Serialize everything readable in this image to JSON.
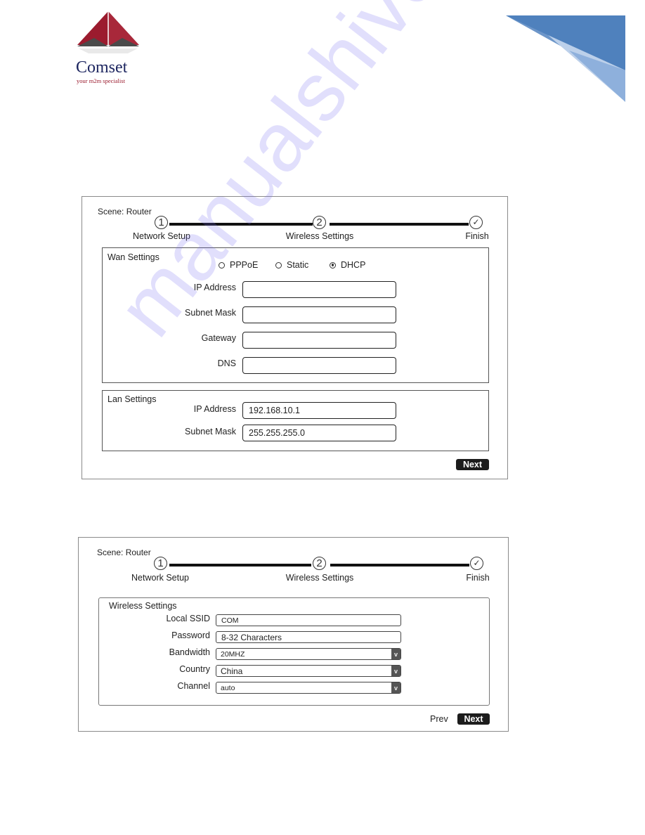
{
  "header": {
    "logo_name": "Comset",
    "logo_tagline": "your m2m specialist",
    "brand_colors": {
      "triangle_red": "#9b1b2e",
      "triangle_gray": "#4a4a4a",
      "name_navy": "#1d2660",
      "corner_blue": "#4f81bd"
    }
  },
  "screen1": {
    "scene_label": "Scene: Router",
    "steps": [
      {
        "number": "1",
        "label": "Network Setup"
      },
      {
        "number": "2",
        "label": "Wireless Settings"
      },
      {
        "icon": "check-icon",
        "label": "Finish"
      }
    ],
    "wan": {
      "title": "Wan Settings",
      "modes": [
        {
          "label": "PPPoE",
          "selected": false
        },
        {
          "label": "Static",
          "selected": false
        },
        {
          "label": "DHCP",
          "selected": true
        }
      ],
      "fields": [
        {
          "label": "IP Address",
          "value": ""
        },
        {
          "label": "Subnet Mask",
          "value": ""
        },
        {
          "label": "Gateway",
          "value": ""
        },
        {
          "label": "DNS",
          "value": ""
        }
      ]
    },
    "lan": {
      "title": "Lan Settings",
      "fields": [
        {
          "label": "IP Address",
          "value": "192.168.10.1"
        },
        {
          "label": "Subnet Mask",
          "value": "255.255.255.0"
        }
      ]
    },
    "next_label": "Next"
  },
  "screen2": {
    "scene_label": "Scene: Router",
    "steps": [
      {
        "number": "1",
        "label": "Network Setup"
      },
      {
        "number": "2",
        "label": "Wireless Settings"
      },
      {
        "icon": "check-icon",
        "label": "Finish"
      }
    ],
    "wireless": {
      "title": "Wireless Settings",
      "fields": [
        {
          "label": "Local SSID",
          "value": "COM",
          "type": "text"
        },
        {
          "label": "Password",
          "value": "8-32 Characters",
          "type": "text"
        },
        {
          "label": "Bandwidth",
          "value": "20MHZ",
          "type": "select"
        },
        {
          "label": "Country",
          "value": "China",
          "type": "select"
        },
        {
          "label": "Channel",
          "value": "auto",
          "type": "select"
        }
      ],
      "select_glyph": "v"
    },
    "prev_label": "Prev",
    "next_label": "Next"
  },
  "watermark": "manualshive.com"
}
